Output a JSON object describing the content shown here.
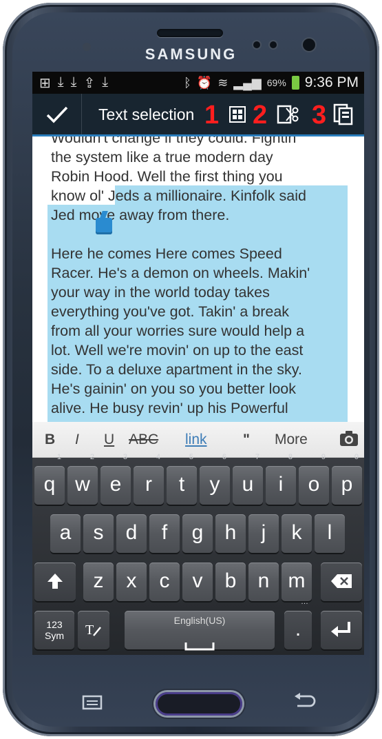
{
  "device": {
    "brand": "SAMSUNG"
  },
  "statusbar": {
    "left_icons": [
      "plus-icon",
      "download-icon",
      "download-icon",
      "upload-icon",
      "download-icon"
    ],
    "battery_pct": "69%",
    "time": "9:36 PM"
  },
  "actionbar": {
    "title": "Text selection",
    "annotations": [
      "1",
      "2",
      "3"
    ],
    "buttons": [
      "select-all-icon",
      "cut-icon",
      "copy-icon"
    ]
  },
  "editor": {
    "lines": [
      "Wouldn't change if they could. Fightin'",
      "the system like a true modern day",
      "Robin Hood. Well the first thing you",
      "know ol' Jeds a millionaire. Kinfolk said",
      "Jed move away from there.",
      "",
      "Here he comes Here comes Speed",
      "Racer. He's a demon on wheels. Makin'",
      "your way in the world today takes",
      "everything you've got. Takin' a break",
      "from all your worries sure would help a",
      "lot. Well we're movin' on up to the east",
      "side. To a deluxe apartment in the sky.",
      "He's gainin' on you so you better look",
      "alive. He busy revin' up his Powerful"
    ]
  },
  "format_toolbar": {
    "bold": "B",
    "italic": "I",
    "underline": "U",
    "strike": "ABC",
    "link": "link",
    "quote": "\"",
    "more": "More"
  },
  "keyboard": {
    "row1": [
      {
        "k": "q",
        "n": "1"
      },
      {
        "k": "w",
        "n": "2"
      },
      {
        "k": "e",
        "n": "3"
      },
      {
        "k": "r",
        "n": "4"
      },
      {
        "k": "t",
        "n": "5"
      },
      {
        "k": "y",
        "n": "6"
      },
      {
        "k": "u",
        "n": "7"
      },
      {
        "k": "i",
        "n": "8"
      },
      {
        "k": "o",
        "n": "9"
      },
      {
        "k": "p",
        "n": "0"
      }
    ],
    "row2": [
      "a",
      "s",
      "d",
      "f",
      "g",
      "h",
      "j",
      "k",
      "l"
    ],
    "row3": [
      "z",
      "x",
      "c",
      "v",
      "b",
      "n",
      "m"
    ],
    "sym_label_1": "123",
    "sym_label_2": "Sym",
    "space_label": "English(US)",
    "period": ".",
    "period_sup": "…"
  }
}
